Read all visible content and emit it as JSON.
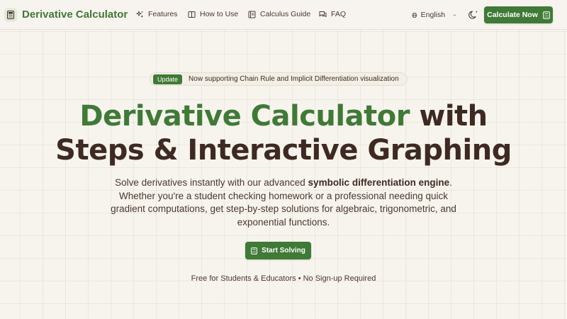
{
  "brand": {
    "name": "Derivative Calculator",
    "color": "#3f7a36"
  },
  "nav": {
    "items": [
      {
        "label": "Features",
        "icon": "sparkles-icon"
      },
      {
        "label": "How to Use",
        "icon": "book-icon"
      },
      {
        "label": "Calculus Guide",
        "icon": "book-open-icon"
      },
      {
        "label": "FAQ",
        "icon": "chat-icon"
      }
    ],
    "language": "English",
    "theme_icon": "moon-icon",
    "cta_label": "Calculate Now"
  },
  "announcement": {
    "badge": "Update",
    "text": "Now supporting Chain Rule and Implicit Differentiation visualization"
  },
  "hero": {
    "title_accent": "Derivative Calculator",
    "title_rest_line1": " with",
    "title_line2": "Steps & Interactive Graphing",
    "description_pre": "Solve derivatives instantly with our advanced ",
    "description_bold": "symbolic differentiation engine",
    "description_post": ". Whether you're a student checking homework or a professional needing quick gradient computations, get step-by-step solutions for algebraic, trigonometric, and exponential functions.",
    "cta_label": "Start Solving",
    "footnote": "Free for Students & Educators • No Sign-up Required"
  },
  "colors": {
    "accent": "#3f7a36",
    "text": "#3e2a22",
    "background": "#f7f4ee"
  }
}
